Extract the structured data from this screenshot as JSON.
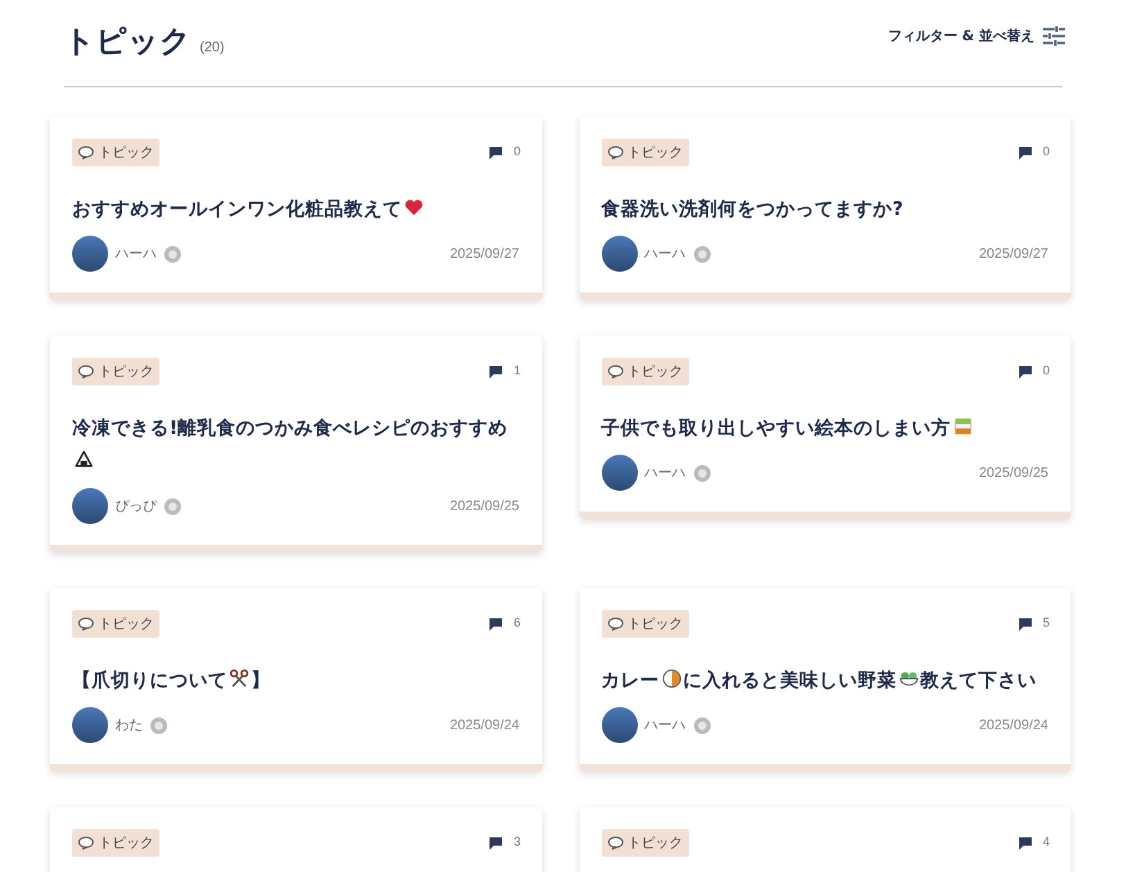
{
  "header": {
    "title": "トピック",
    "count": "(20)",
    "filter_label": "フィルター & 並べ替え"
  },
  "cards": [
    {
      "tag": "トピック",
      "comments": "0",
      "title": [
        {
          "kind": "text",
          "text": "おすすめオールインワン化粧品教えて"
        },
        {
          "kind": "emoji"
        }
      ],
      "author": "ハーハ",
      "date": "2025/09/27"
    },
    {
      "tag": "トピック",
      "comments": "0",
      "title": [
        {
          "kind": "text",
          "text": "食器洗い洗剤何をつかってますか?"
        }
      ],
      "author": "ハーハ",
      "date": "2025/09/27"
    },
    {
      "tag": "トピック",
      "comments": "1",
      "title": [
        {
          "kind": "text",
          "text": "冷凍できる!離乳食のつかみ食べレシピのおすすめ"
        },
        {
          "kind": "emoji"
        }
      ],
      "author": "ぴっぴ",
      "date": "2025/09/25"
    },
    {
      "tag": "トピック",
      "comments": "0",
      "title": [
        {
          "kind": "text",
          "text": "子供でも取り出しやすい絵本のしまい方"
        },
        {
          "kind": "emoji"
        }
      ],
      "author": "ハーハ",
      "date": "2025/09/25"
    },
    {
      "tag": "トピック",
      "comments": "6",
      "title": [
        {
          "kind": "text",
          "text": "【爪切りについて"
        },
        {
          "kind": "emoji"
        },
        {
          "kind": "text",
          "text": "】"
        }
      ],
      "author": "わた",
      "date": "2025/09/24"
    },
    {
      "tag": "トピック",
      "comments": "5",
      "title": [
        {
          "kind": "text",
          "text": "カレー"
        },
        {
          "kind": "emoji"
        },
        {
          "kind": "text",
          "text": "に入れると美味しい野菜"
        },
        {
          "kind": "emoji"
        },
        {
          "kind": "text",
          "text": "教えて下さい"
        }
      ],
      "author": "ハーハ",
      "date": "2025/09/24"
    },
    {
      "tag": "トピック",
      "comments": "3"
    },
    {
      "tag": "トピック",
      "comments": "4"
    }
  ]
}
